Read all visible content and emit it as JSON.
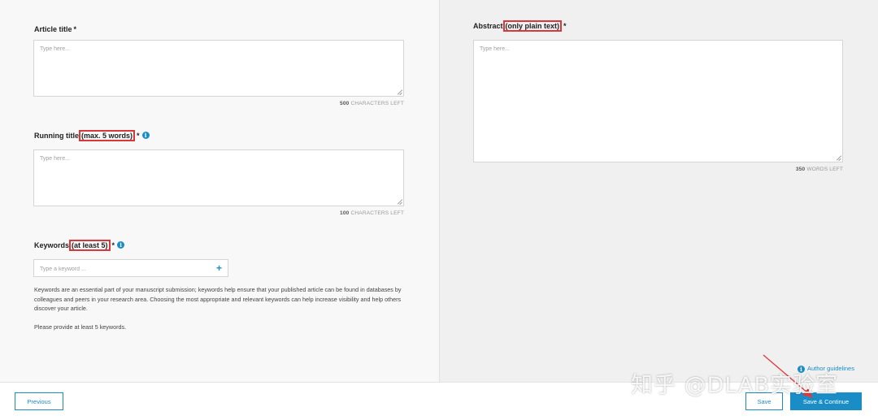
{
  "form": {
    "article_title": {
      "label": "Article title",
      "required": "*",
      "placeholder": "Type here...",
      "counter_value": "500",
      "counter_unit": "CHARACTERS LEFT"
    },
    "running_title": {
      "label": "Running title",
      "hint": "(max. 5 words)",
      "required": "*",
      "placeholder": "Type here...",
      "counter_value": "100",
      "counter_unit": "CHARACTERS LEFT"
    },
    "keywords": {
      "label": "Keywords",
      "hint": "(at least 5)",
      "required": "*",
      "placeholder": "Type a keyword ...",
      "add_symbol": "+",
      "help_text": "Keywords are an essential part of your manuscript submission; keywords help ensure that your published article can be found in databases by colleagues and peers in your research area. Choosing the most appropriate and relevant keywords can help increase visibility and help others discover your article.",
      "help_note": "Please provide at least 5 keywords."
    },
    "abstract": {
      "label": "Abstract",
      "hint": "(only plain text)",
      "required": "*",
      "placeholder": "Type here...",
      "counter_value": "350",
      "counter_unit": "WORDS LEFT"
    }
  },
  "info_glyph": "i",
  "footer": {
    "previous_label": "Previous",
    "save_label": "Save",
    "save_continue_label": "Save & Continue",
    "author_guidelines_label": "Author guidelines"
  },
  "watermark": {
    "text": "知乎 @DLAB实验室"
  },
  "colors": {
    "accent": "#1a8dc7",
    "highlight": "#d9373a"
  }
}
